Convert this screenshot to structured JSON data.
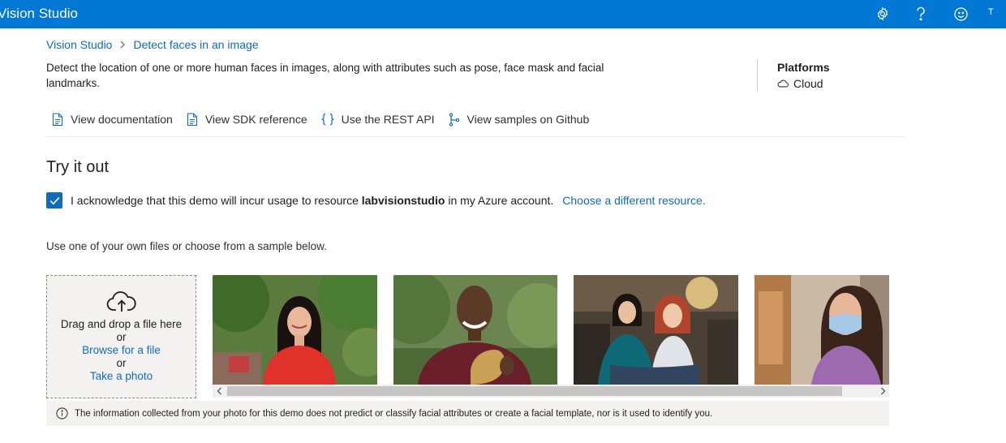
{
  "header": {
    "app_title": "Vision Studio",
    "icons": [
      "gear-icon",
      "help-icon",
      "feedback-smiley-icon"
    ],
    "avatar_initial": "T",
    "brand_color": "#0078d4"
  },
  "breadcrumb": {
    "root": "Vision Studio",
    "separator": ">",
    "current": "Detect faces in an image"
  },
  "description": "Detect the location of one or more human faces in images, along with attributes such as pose, face mask and facial landmarks.",
  "platforms": {
    "title": "Platforms",
    "item": "Cloud"
  },
  "resource_links": [
    {
      "label": "View documentation",
      "icon": "document-icon"
    },
    {
      "label": "View SDK reference",
      "icon": "document-icon"
    },
    {
      "label": "Use the REST API",
      "icon": "curly-braces-icon"
    },
    {
      "label": "View samples on Github",
      "icon": "branch-icon"
    }
  ],
  "try_it_out": {
    "title": "Try it out",
    "ack_checked": true,
    "ack_prefix": "I acknowledge that this demo will incur usage to resource",
    "ack_resource": "labvisionstudio",
    "ack_suffix": "in my Azure account.",
    "ack_link": "Choose a different resource."
  },
  "samples_hint": "Use one of your own files or choose from a sample below.",
  "dropzone": {
    "icon": "cloud-upload-icon",
    "line1": "Drag and drop a file here",
    "or1": "or",
    "browse": "Browse for a file",
    "or2": "or",
    "photo": "Take a photo"
  },
  "samples": [
    {
      "subject": "woman in red top outdoors"
    },
    {
      "subject": "smiling man holding face mask"
    },
    {
      "subject": "two women in store"
    },
    {
      "subject": "woman wearing face mask"
    }
  ],
  "notice": {
    "icon": "info-icon",
    "text": "The information collected from your photo for this demo does not predict or classify facial attributes or create a facial template, nor is it used to identify you."
  },
  "colors": {
    "accent": "#0f6cbd",
    "panel": "#f3f2f1"
  }
}
